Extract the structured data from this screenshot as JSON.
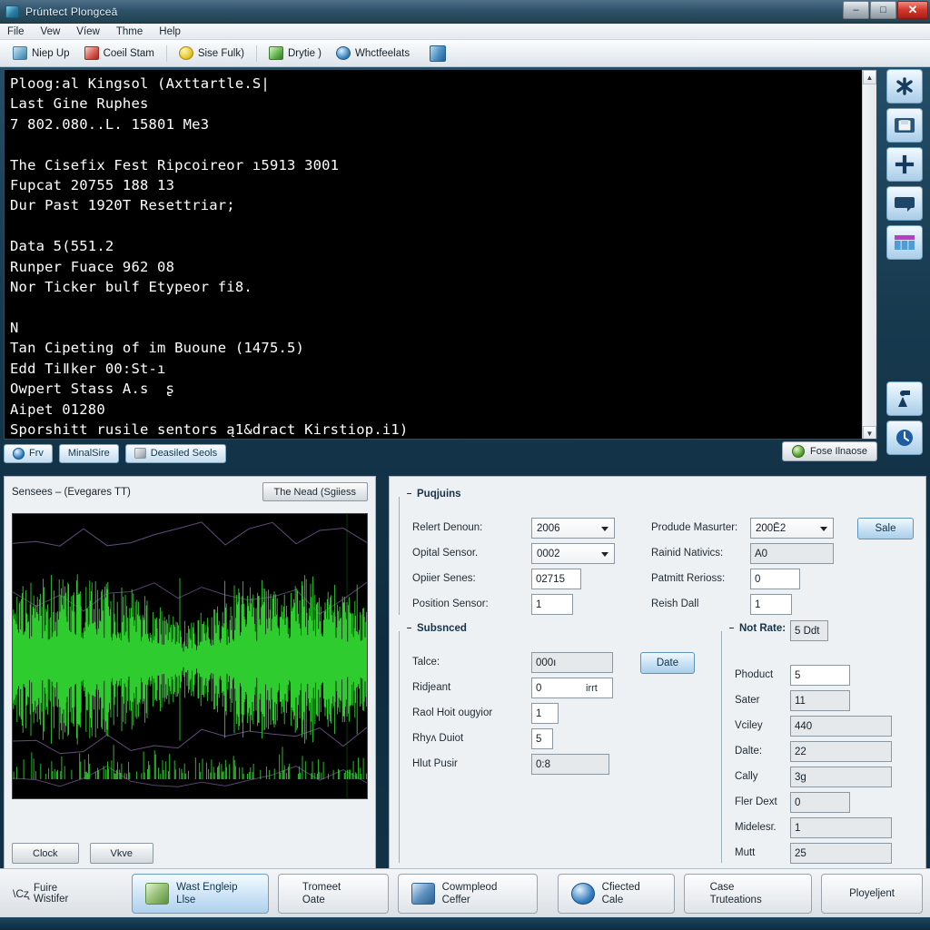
{
  "window": {
    "title": "Prúntect Plongceā",
    "icon": "window-app-icon",
    "minimize": "–",
    "maximize": "□",
    "close": "✕"
  },
  "menubar": {
    "items": [
      "File",
      "Vew",
      "Víew",
      "Thme",
      "Help"
    ]
  },
  "toolbar": {
    "items": [
      {
        "label": "Niep Up",
        "icon": "blue"
      },
      {
        "label": "Coeil Stam",
        "icon": "red"
      },
      {
        "label": "Sise Fulk)",
        "icon": "yellow"
      },
      {
        "label": "Drytie )",
        "icon": "green"
      },
      {
        "label": "Whctfeelats",
        "icon": "globe"
      },
      {
        "label": "",
        "icon": "door"
      }
    ]
  },
  "console": {
    "text": "Ploog:al Kingsol (Axttartle.S|\nLast Gine Ruphes\n7 802.080..L. 15801 Me3\n\nThe Cisefix Fest Ripcoireor ı5913 3001\nFupcat 20755 188 13\nDur Past 1920T Resettriar;\n\nData 5(551.2\nRunper Fuace 962 08\nNor Ticker bulf Etypeor fi8.\n\nN\nTan Cipeting of im Buoune (1475.5)\nEdd Tiǁker 00:St-ı\nOwpert Stass A.s  ʂ\nAipet 01280\nSporshitt rusile sentors ą1&dract Kirstiop.i1)",
    "scroll_up": "▲",
    "scroll_down": "▼"
  },
  "console_tabs": [
    {
      "label": "Frv",
      "icon": "circle-blue-icon"
    },
    {
      "label": "MinalSire",
      "icon": "none"
    },
    {
      "label": "Deasiled Seols",
      "icon": "square-gray-icon"
    }
  ],
  "console_action": {
    "label": "Fose Ilnaose",
    "icon": "world-green-icon"
  },
  "rail": [
    {
      "name": "asterisk-icon",
      "glyph": "asterisk"
    },
    {
      "name": "save-disk-icon",
      "glyph": "disk"
    },
    {
      "name": "plus-icon",
      "glyph": "plus"
    },
    {
      "name": "window-icon",
      "glyph": "window"
    },
    {
      "name": "table-icon",
      "glyph": "table"
    },
    {
      "name": "flag-person-icon",
      "glyph": "flagperson"
    },
    {
      "name": "history-clock-icon",
      "glyph": "clock"
    }
  ],
  "graph_panel": {
    "title": "Sensees – (Evegares TT)",
    "head_button": "The Nead (Sgiiess",
    "footer_buttons": [
      "Clock",
      "Vkve"
    ]
  },
  "form": {
    "group1": {
      "title": "Puqjuins",
      "collapse": "–",
      "fields": [
        {
          "label": "Relert Denoun:",
          "value": "2006",
          "type": "select"
        },
        {
          "label": "Opital Sensor.",
          "value": "0002",
          "type": "select"
        },
        {
          "label": "Opiier Senes:",
          "value": "02715",
          "type": "input"
        },
        {
          "label": "Position Sensor:",
          "value": "1",
          "type": "input"
        },
        {
          "label": "Produde Masurter:",
          "value": "200Ē2",
          "type": "select"
        },
        {
          "label": "Rainid Nativics:",
          "value": "A0",
          "type": "input-gray"
        },
        {
          "label": "Patmitt Rerioss:",
          "value": "0",
          "type": "input"
        },
        {
          "label": "Reish Dall",
          "value": "1",
          "type": "input"
        }
      ],
      "button": "Sale"
    },
    "group2": {
      "title": "Subsnced",
      "collapse": "–",
      "fields": [
        {
          "label": "Talce:",
          "value": "000ı",
          "type": "input-gray"
        },
        {
          "label": "Ridjeant",
          "value": "0",
          "suffix": "irrt",
          "type": "input"
        },
        {
          "label": "Raol Hoit ougyior",
          "value": "1",
          "type": "input"
        },
        {
          "label": "Rhyʌ Duiot",
          "value": "5",
          "type": "input"
        },
        {
          "label": "Hlut Pusir",
          "value": "0:8",
          "type": "input-gray"
        }
      ],
      "button": "Date"
    },
    "group3": {
      "title": "Not Rate:",
      "collapse": "–",
      "header_value": "5 Ddt",
      "fields": [
        {
          "label": "Phoduct",
          "value": "5",
          "type": "input"
        },
        {
          "label": "Sater",
          "value": "11",
          "type": "input-gray"
        },
        {
          "label": "Vciley",
          "value": "440",
          "type": "input-gray"
        },
        {
          "label": "Dalte:",
          "value": "22",
          "type": "input-gray"
        },
        {
          "label": "Cally",
          "value": "3ɡ",
          "type": "input-gray"
        },
        {
          "label": "Fler Dext",
          "value": "0",
          "type": "input-gray"
        },
        {
          "label": "Midelesг.",
          "value": "1",
          "type": "input-gray"
        },
        {
          "label": "Mutt",
          "value": "25",
          "type": "input-gray"
        }
      ]
    }
  },
  "bottombar": {
    "note": "Fuire Wistifer",
    "note_cursor": "\\Сʐ",
    "buttons": [
      {
        "label": "Wast Engleip Llse",
        "icon": "image-icon",
        "primary": true
      },
      {
        "label": "Tromeet Oate",
        "icon": "none",
        "primary": false
      },
      {
        "label": "Cowmpleod Ceffer",
        "icon": "list-icon",
        "primary": false
      },
      {
        "label": "Cfiected Cale",
        "icon": "phone-icon",
        "primary": false
      },
      {
        "label": "Case Truteations",
        "icon": "none",
        "primary": false
      },
      {
        "label": "Ployeljent",
        "icon": "none",
        "primary": false
      }
    ]
  },
  "colors": {
    "title_bar": "#2f536b",
    "console_bg": "#000000",
    "waveform": "#2ecc2e",
    "waveform_secondary": "#7a5f9a",
    "accent_blue": "#a9cfea",
    "close_red": "#d2362c"
  }
}
